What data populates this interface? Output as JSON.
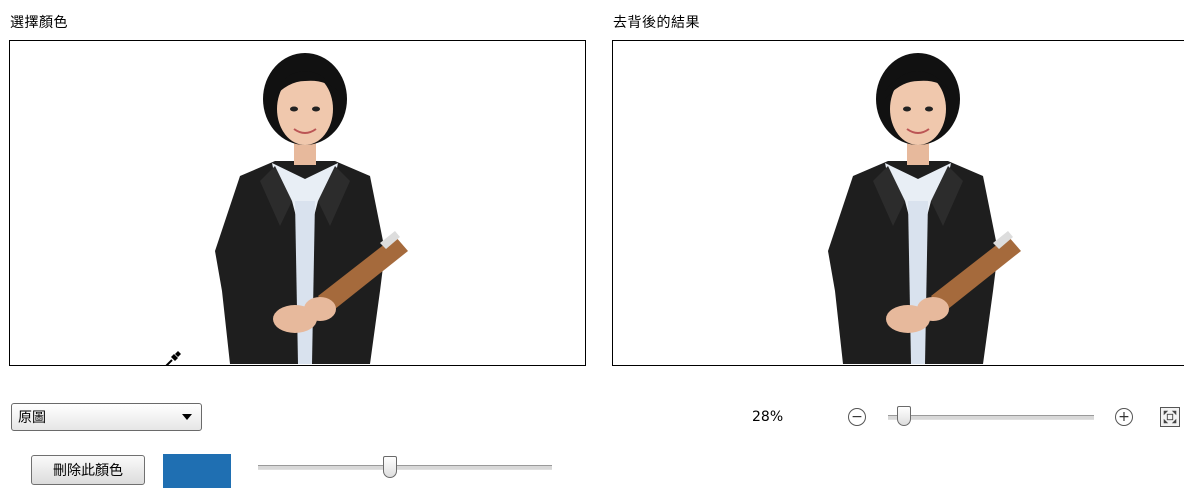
{
  "panels": {
    "select_color_title": "選擇顏色",
    "result_title": "去背後的結果"
  },
  "controls": {
    "view_dropdown_value": "原圖",
    "delete_color_button": "刪除此顏色",
    "selected_color": "#1F6FB2",
    "tolerance_slider_level": 0.45,
    "zoom_label": "28%",
    "zoom_slider_level": 0.08
  },
  "icons": {
    "zoom_out": "minus-circle-icon",
    "zoom_in": "plus-circle-icon",
    "fit": "fit-to-window-icon",
    "cursor": "eyedropper-icon"
  }
}
